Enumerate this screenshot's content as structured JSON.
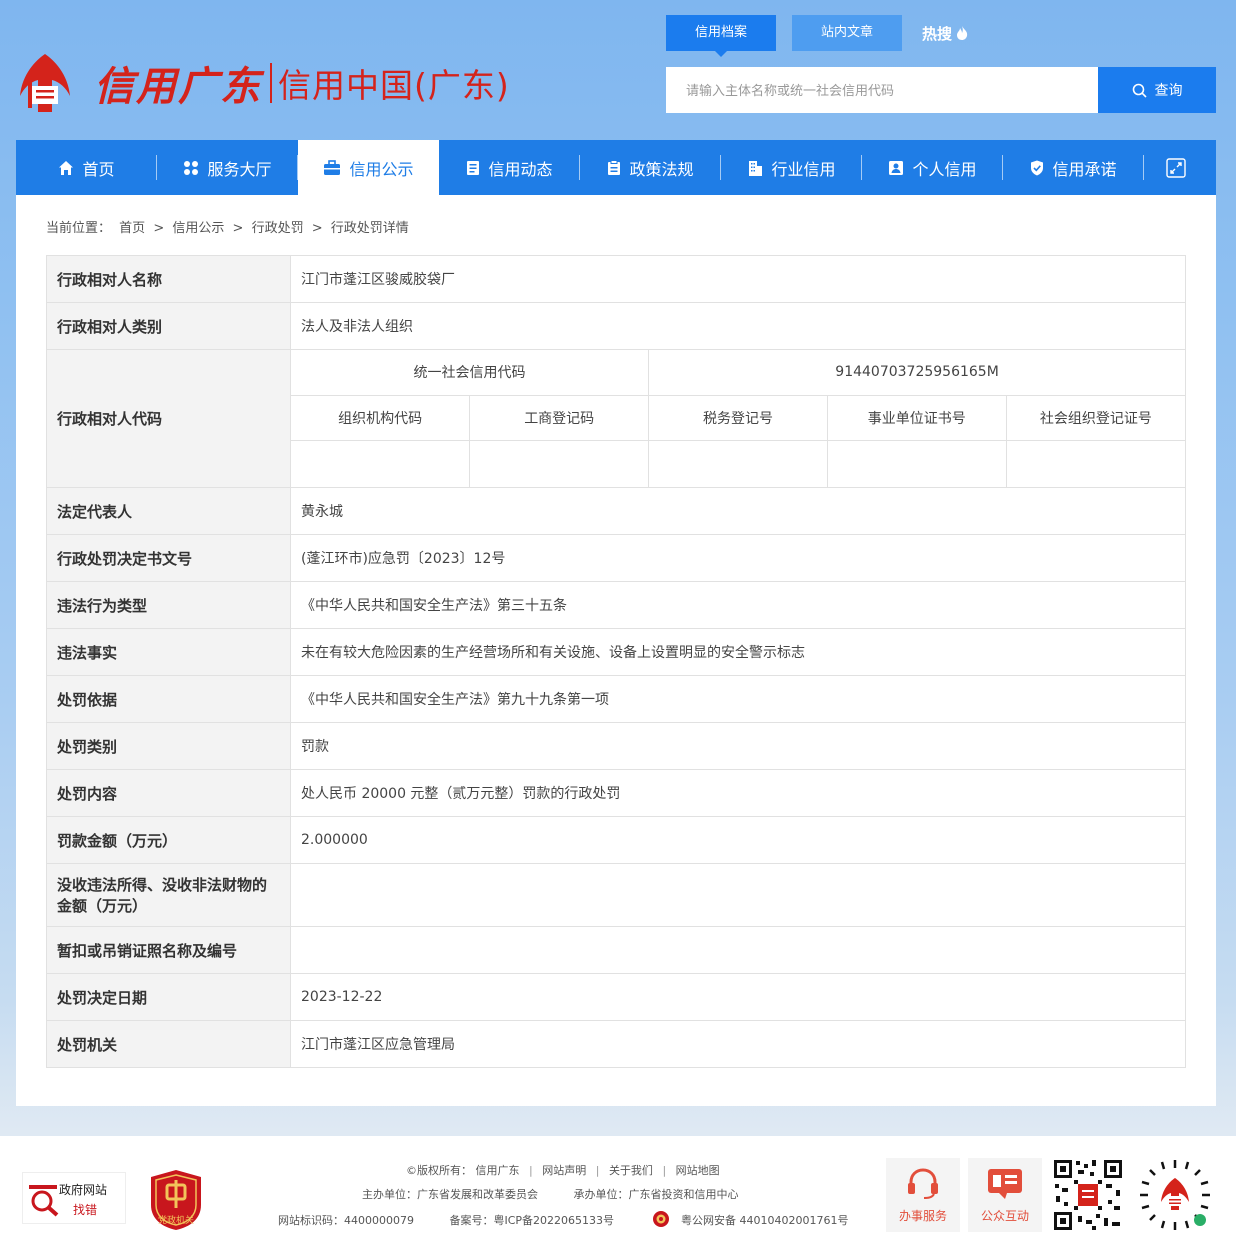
{
  "header": {
    "logo_script": "信用广东",
    "logo_text": "信用中国(广东)",
    "top_tabs": [
      {
        "label": "信用档案",
        "active": true
      },
      {
        "label": "站内文章",
        "active": false
      }
    ],
    "hot_label": "热搜",
    "search_placeholder": "请输入主体名称或统一社会信用代码",
    "search_button": "查询"
  },
  "nav": {
    "items": [
      {
        "label": "首页",
        "icon": "home-icon"
      },
      {
        "label": "服务大厅",
        "icon": "grid-icon"
      },
      {
        "label": "信用公示",
        "icon": "briefcase-icon",
        "active": true
      },
      {
        "label": "信用动态",
        "icon": "document-icon"
      },
      {
        "label": "政策法规",
        "icon": "clipboard-icon"
      },
      {
        "label": "行业信用",
        "icon": "building-icon"
      },
      {
        "label": "个人信用",
        "icon": "id-card-icon"
      },
      {
        "label": "信用承诺",
        "icon": "shield-check-icon"
      }
    ]
  },
  "breadcrumb": {
    "prefix": "当前位置：",
    "items": [
      "首页",
      "信用公示",
      "行政处罚",
      "行政处罚详情"
    ],
    "separator": ">"
  },
  "detail": {
    "name_label": "行政相对人名称",
    "name_value": "江门市蓬江区骏威胶袋厂",
    "type_label": "行政相对人类别",
    "type_value": "法人及非法人组织",
    "code_label": "行政相对人代码",
    "uscc_label": "统一社会信用代码",
    "uscc_value": "91440703725956165M",
    "code_headers": [
      "组织机构代码",
      "工商登记码",
      "税务登记号",
      "事业单位证书号",
      "社会组织登记证号"
    ],
    "code_values": [
      "",
      "",
      "",
      "",
      ""
    ],
    "rows": [
      {
        "label": "法定代表人",
        "value": "黄永城"
      },
      {
        "label": "行政处罚决定书文号",
        "value": "(蓬江环市)应急罚〔2023〕12号"
      },
      {
        "label": "违法行为类型",
        "value": "《中华人民共和国安全生产法》第三十五条"
      },
      {
        "label": "违法事实",
        "value": "未在有较大危险因素的生产经营场所和有关设施、设备上设置明显的安全警示标志"
      },
      {
        "label": "处罚依据",
        "value": "《中华人民共和国安全生产法》第九十九条第一项"
      },
      {
        "label": "处罚类别",
        "value": "罚款"
      },
      {
        "label": "处罚内容",
        "value": "处人民币 20000 元整（贰万元整）罚款的行政处罚"
      },
      {
        "label": "罚款金额（万元）",
        "value": "2.000000"
      },
      {
        "label": "没收违法所得、没收非法财物的金额（万元）",
        "value": ""
      },
      {
        "label": "暂扣或吊销证照名称及编号",
        "value": ""
      },
      {
        "label": "处罚决定日期",
        "value": "2023-12-22"
      },
      {
        "label": "处罚机关",
        "value": "江门市蓬江区应急管理局"
      }
    ]
  },
  "footer": {
    "gov_badge_line1": "政府网站",
    "gov_badge_line2": "找错",
    "party_badge": "党政机关",
    "copyright_prefix": "©版权所有：",
    "links": [
      "信用广东",
      "网站声明",
      "关于我们",
      "网站地图"
    ],
    "sponsor": "主办单位：广东省发展和改革委员会",
    "undertaker": "承办单位：广东省投资和信用中心",
    "site_id": "网站标识码：4400000079",
    "icp": "备案号：粤ICP备2022065133号",
    "police": "粤公网安备 44010402001761号",
    "service_label": "办事服务",
    "interact_label": "公众互动"
  },
  "colors": {
    "primary": "#1f7de6",
    "brand_red": "#d4231b",
    "label_bg": "#f3f3f3",
    "border": "#e1e1e1"
  }
}
